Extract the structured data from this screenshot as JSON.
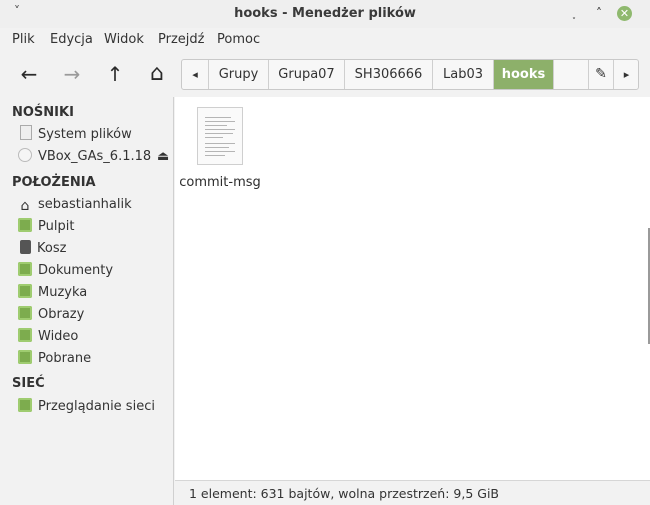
{
  "window": {
    "title": "hooks - Menedżer plików",
    "menu_glyph": "˅",
    "minimize_glyph": "˯",
    "maximize_glyph": "˄",
    "close_glyph": "✕"
  },
  "menubar": [
    "Plik",
    "Edycja",
    "Widok",
    "Przejdź",
    "Pomoc"
  ],
  "toolbar": {
    "back_glyph": "←",
    "forward_glyph": "→",
    "up_glyph": "↑",
    "home_glyph": "⌂",
    "path": [
      "Grupy",
      "Grupa07",
      "SH306666",
      "Lab03",
      "hooks"
    ],
    "active_index": 4,
    "path_left_glyph": "◂",
    "path_right_glyph": "▸",
    "edit_glyph": "✎"
  },
  "sidebar": {
    "devices_header": "NOŚNIKI",
    "devices": [
      {
        "label": "System plików",
        "icon": "drive-icon"
      },
      {
        "label": "VBox_GAs_6.1.18",
        "icon": "disc-icon",
        "eject_glyph": "⏏"
      }
    ],
    "places_header": "POŁOŻENIA",
    "places": [
      {
        "label": "sebastianhalik",
        "icon": "home-icon"
      },
      {
        "label": "Pulpit",
        "icon": "desktop-icon"
      },
      {
        "label": "Kosz",
        "icon": "trash-icon"
      },
      {
        "label": "Dokumenty",
        "icon": "folder-documents-icon"
      },
      {
        "label": "Muzyka",
        "icon": "folder-music-icon"
      },
      {
        "label": "Obrazy",
        "icon": "folder-pictures-icon"
      },
      {
        "label": "Wideo",
        "icon": "folder-videos-icon"
      },
      {
        "label": "Pobrane",
        "icon": "folder-downloads-icon"
      }
    ],
    "network_header": "SIEĆ",
    "network": [
      {
        "label": "Przeglądanie sieci",
        "icon": "network-icon"
      }
    ]
  },
  "files": [
    {
      "name": "commit-msg",
      "icon": "text-file-icon"
    }
  ],
  "status": "1 element: 631 bajtów, wolna przestrzeń: 9,5 GiB",
  "colors": {
    "accent": "#8db06a",
    "close": "#8fb96e",
    "folder": "#7dac4e"
  }
}
